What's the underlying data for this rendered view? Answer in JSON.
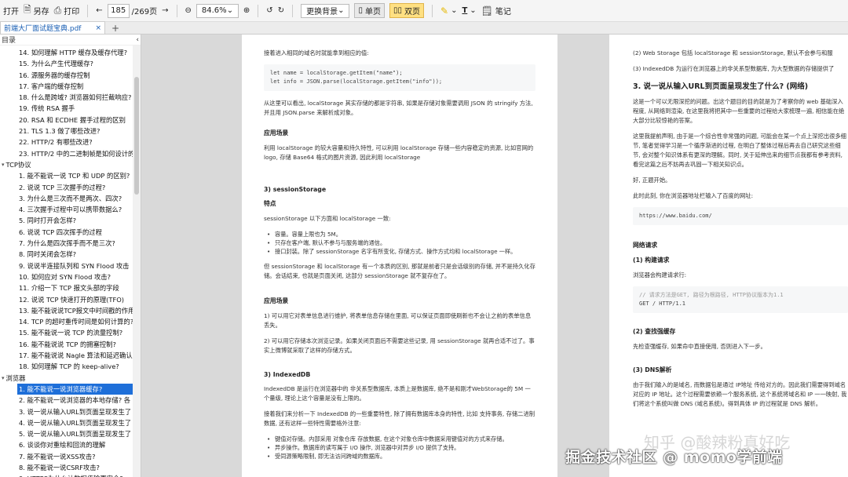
{
  "toolbar": {
    "open": "打开",
    "save_as": "另存",
    "print": "打印",
    "page_current": "185",
    "page_total": "/269页",
    "zoom": "84.6%",
    "bg_label": "更换背景",
    "single_page": "单页",
    "double_page": "双页",
    "text_tool": "T",
    "notes": "笔记"
  },
  "tab": {
    "title": "前端大厂面试题宝典.pdf",
    "close": "×",
    "add": "+"
  },
  "sidebar": {
    "title": "目录",
    "items": [
      {
        "text": "14. 如何理解 HTTP 缓存及缓存代理?",
        "type": "item"
      },
      {
        "text": "15. 为什么产生代理缓存?",
        "type": "item"
      },
      {
        "text": "16. 源服务器的缓存控制",
        "type": "item"
      },
      {
        "text": "17. 客户端的缓存控制",
        "type": "item"
      },
      {
        "text": "18. 什么是跨域? 浏览器如何拦截响应?",
        "type": "item"
      },
      {
        "text": "19. 传统 RSA 握手",
        "type": "item"
      },
      {
        "text": "20. RSA 和 ECDHE 握手过程的区别",
        "type": "item"
      },
      {
        "text": "21. TLS 1.3 做了哪些改进?",
        "type": "item"
      },
      {
        "text": "22. HTTP/2 有哪些改进?",
        "type": "item"
      },
      {
        "text": "23. HTTP/2 中的二进制帧是如何设计的?",
        "type": "item"
      },
      {
        "text": "TCP协议",
        "type": "section"
      },
      {
        "text": "1. 能不能说一说 TCP 和 UDP 的区别?",
        "type": "item"
      },
      {
        "text": "2. 说说 TCP 三次握手的过程?",
        "type": "item"
      },
      {
        "text": "3. 为什么是三次而不是两次、四次?",
        "type": "item"
      },
      {
        "text": "4. 三次握手过程中可以携带数据么?",
        "type": "item"
      },
      {
        "text": "5. 同时打开会怎样?",
        "type": "item"
      },
      {
        "text": "6. 说说 TCP 四次挥手的过程",
        "type": "item"
      },
      {
        "text": "7. 为什么是四次挥手而不是三次?",
        "type": "item"
      },
      {
        "text": "8. 同时关闭会怎样?",
        "type": "item"
      },
      {
        "text": "9. 说说半连接队列和 SYN Flood 攻击",
        "type": "item"
      },
      {
        "text": "10. 如何应对 SYN Flood 攻击?",
        "type": "item"
      },
      {
        "text": "11. 介绍一下 TCP 报文头部的字段",
        "type": "item"
      },
      {
        "text": "12. 说说 TCP 快速打开的原理(TFO)",
        "type": "item"
      },
      {
        "text": "13. 能不能说说TCP报文中时间戳的作用?",
        "type": "item"
      },
      {
        "text": "14. TCP 的超时重传时间是如何计算的?",
        "type": "item"
      },
      {
        "text": "15. 能不能说一说 TCP 的流量控制?",
        "type": "item"
      },
      {
        "text": "16. 能不能说说 TCP 的拥塞控制?",
        "type": "item"
      },
      {
        "text": "17. 能不能说说 Nagle 算法和延迟确认?",
        "type": "item"
      },
      {
        "text": "18. 如何理解 TCP 的 keep-alive?",
        "type": "item"
      },
      {
        "text": "浏览器",
        "type": "section"
      },
      {
        "text": "1. 能不能说一说浏览器缓存?",
        "type": "active"
      },
      {
        "text": "2. 能不能说一说浏览器的本地存储? 各",
        "type": "item"
      },
      {
        "text": "3. 说一说从输入URL到页面呈现发生了",
        "type": "item"
      },
      {
        "text": "4. 说一说从输入URL到页面呈现发生了",
        "type": "item"
      },
      {
        "text": "5. 说一说从输入URL到页面呈现发生了",
        "type": "item"
      },
      {
        "text": "6. 谈谈你对重绘和回流的理解",
        "type": "item"
      },
      {
        "text": "7. 能不能说一说XSS攻击?",
        "type": "item"
      },
      {
        "text": "8. 能不能说一说CSRF攻击?",
        "type": "item"
      },
      {
        "text": "9. HTTPS为什么让数据传输更安全?",
        "type": "item"
      },
      {
        "text": "10. 能不能说一说浏览器跨域?",
        "type": "item"
      }
    ]
  },
  "page1": {
    "intro": "接着进入相同的域名时就能拿到相应的值:",
    "code1": [
      "let name = localStorage.getItem(\"name\");",
      "let info = JSON.parse(localStorage.getItem(\"info\"));"
    ],
    "para1": "从这里可以看出, localStorage 其实存储的都是字符串, 如果是存储对象需要调用 JSON 的 stringify 方法, 并且用 JSON.parse 来解析成对象。",
    "h_scene1": "应用场景",
    "scene1": "利用 localStorage 的较大容量和持久特性, 可以利用 localStorage 存储一些内容稳定的资源, 比如官网的 logo, 存储 Base64 格式的图片资源, 因此利用 localStorage",
    "h_session": "3) sessionStorage",
    "h_feature": "特点",
    "feature_intro": "sessionStorage 以下方面和 localStorage 一致:",
    "features": [
      "容量。容量上限也为 5M。",
      "只存在客户端, 默认不参与与服务端的通信。",
      "接口封装。除了 sessionStorage 名字有所变化, 存储方式、操作方式均和 localStorage 一样。"
    ],
    "para2": "但 sessionStorage 和 localStorage 有一个本质的区别, 那就是前者只是会话级别的存储, 并不是持久化存储。会话结束, 也就是页面关闭, 这部分 sessionStorage 就不复存在了。",
    "h_scene2": "应用场景",
    "scene2a": "1) 可以用它对表单信息进行维护, 将表单信息存储在里面, 可以保证页面即使刷新也不会让之前的表单信息丢失。",
    "scene2b": "2) 可以用它存储本次浏览记录。如果关闭页面后不需要这些记录, 用 sessionStorage 就再合适不过了。事实上微博就采取了这样的存储方式。",
    "h_indexed": "3) IndexedDB",
    "indexed_p1": "IndexedDB 是运行在浏览器中的 非关系型数据库, 本质上是数据库, 绝不是和刚才WebStorage的 5M 一个量级, 理论上这个容量是没有上限的。",
    "indexed_p2": "接着我们来分析一下 IndexedDB 的一些重要特性, 除了拥有数据库本身的特性, 比如 支持事务, 存储二进制数据, 还有这样一些特性需要格外注意:",
    "indexed_list": [
      "键值对存储。内部采用 对象仓库 存放数据, 在这个对象仓库中数据采用键值对的方式来存储。",
      "异步操作。数据库的读写属于 I/O 操作, 浏览器中对异步 I/O 提供了支持。",
      "受同源策略限制, 即无法访问跨域的数据库。"
    ]
  },
  "page2": {
    "top1": "(2) Web Storage 包括 localStorage 和 sessionStorage, 默认不会参与和服",
    "top2": "(3) IndexedDB 为运行在浏览器上的非关系型数据库, 为大型数据的存储提供了",
    "heading": "3. 说一说从输入URL到页面呈现发生了什么? (网络)",
    "p1": "这是一个可以无限深挖的问题。出这个题目的目的就是为了考察你的 web 基础深入程度, 从网络到渲染, 在这里我将把其中一些重要的过程给大家梳理一遍, 相信能在绝大部分比较惊艳的答案。",
    "p2": "这里我提前声明, 由于是一个综合性非常强的问题, 可能会在某一个点上深挖出很多细节, 笔者觉得学习是一个循序渐进的过程, 在明白了整体过程后再去自己研究这些细节, 会对整个知识体系有更深的理解。同时, 关于延伸出来的细节点我都有参考资料, 看完这篇之后不妨再去巩固一下相关知识点。",
    "p3": "好, 正题开始。",
    "p4": "此时此刻, 你在浏览器地址栏输入了百度的网址:",
    "url_code": "https://www.baidu.com/",
    "h_net": "网络请求",
    "h_build": "(1) 构建请求",
    "build_p": "浏览器会构建请求行:",
    "req_comment": "// 请求方法是GET, 路径为根路径, HTTP协议版本为1.1",
    "req_line": "GET / HTTP/1.1",
    "h_cache": "(2) 查找强缓存",
    "cache_p": "先检查强缓存, 如果命中直接使用, 否则进入下一步。",
    "h_dns": "(3) DNS解析",
    "dns_p": "由于我们输入的是域名, 而数据包是通过 IP地址 传给对方的。因此我们需要得到域名对应的 IP 地址。这个过程需要依赖一个服务系统, 这个系统将域名和 IP 一一映射, 我们将这个系统叫做 DNS (域名系统)。得到具体 IP 的过程就是 DNS 解析。"
  },
  "watermark": "掘金技术社区 @ momo学前端",
  "watermark_ghost": "知乎 @酸辣粉真好吃"
}
